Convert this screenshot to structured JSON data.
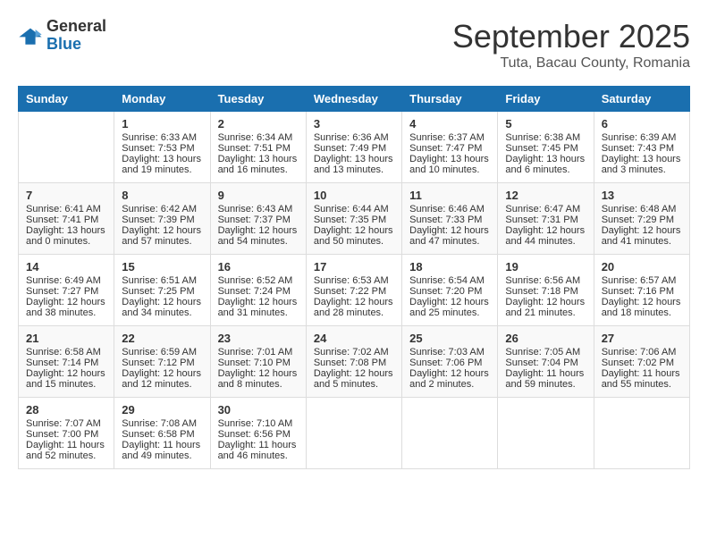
{
  "header": {
    "logo_general": "General",
    "logo_blue": "Blue",
    "month_title": "September 2025",
    "location": "Tuta, Bacau County, Romania"
  },
  "days_of_week": [
    "Sunday",
    "Monday",
    "Tuesday",
    "Wednesday",
    "Thursday",
    "Friday",
    "Saturday"
  ],
  "weeks": [
    [
      {
        "num": "",
        "sunrise": "",
        "sunset": "",
        "daylight": ""
      },
      {
        "num": "1",
        "sunrise": "Sunrise: 6:33 AM",
        "sunset": "Sunset: 7:53 PM",
        "daylight": "Daylight: 13 hours and 19 minutes."
      },
      {
        "num": "2",
        "sunrise": "Sunrise: 6:34 AM",
        "sunset": "Sunset: 7:51 PM",
        "daylight": "Daylight: 13 hours and 16 minutes."
      },
      {
        "num": "3",
        "sunrise": "Sunrise: 6:36 AM",
        "sunset": "Sunset: 7:49 PM",
        "daylight": "Daylight: 13 hours and 13 minutes."
      },
      {
        "num": "4",
        "sunrise": "Sunrise: 6:37 AM",
        "sunset": "Sunset: 7:47 PM",
        "daylight": "Daylight: 13 hours and 10 minutes."
      },
      {
        "num": "5",
        "sunrise": "Sunrise: 6:38 AM",
        "sunset": "Sunset: 7:45 PM",
        "daylight": "Daylight: 13 hours and 6 minutes."
      },
      {
        "num": "6",
        "sunrise": "Sunrise: 6:39 AM",
        "sunset": "Sunset: 7:43 PM",
        "daylight": "Daylight: 13 hours and 3 minutes."
      }
    ],
    [
      {
        "num": "7",
        "sunrise": "Sunrise: 6:41 AM",
        "sunset": "Sunset: 7:41 PM",
        "daylight": "Daylight: 13 hours and 0 minutes."
      },
      {
        "num": "8",
        "sunrise": "Sunrise: 6:42 AM",
        "sunset": "Sunset: 7:39 PM",
        "daylight": "Daylight: 12 hours and 57 minutes."
      },
      {
        "num": "9",
        "sunrise": "Sunrise: 6:43 AM",
        "sunset": "Sunset: 7:37 PM",
        "daylight": "Daylight: 12 hours and 54 minutes."
      },
      {
        "num": "10",
        "sunrise": "Sunrise: 6:44 AM",
        "sunset": "Sunset: 7:35 PM",
        "daylight": "Daylight: 12 hours and 50 minutes."
      },
      {
        "num": "11",
        "sunrise": "Sunrise: 6:46 AM",
        "sunset": "Sunset: 7:33 PM",
        "daylight": "Daylight: 12 hours and 47 minutes."
      },
      {
        "num": "12",
        "sunrise": "Sunrise: 6:47 AM",
        "sunset": "Sunset: 7:31 PM",
        "daylight": "Daylight: 12 hours and 44 minutes."
      },
      {
        "num": "13",
        "sunrise": "Sunrise: 6:48 AM",
        "sunset": "Sunset: 7:29 PM",
        "daylight": "Daylight: 12 hours and 41 minutes."
      }
    ],
    [
      {
        "num": "14",
        "sunrise": "Sunrise: 6:49 AM",
        "sunset": "Sunset: 7:27 PM",
        "daylight": "Daylight: 12 hours and 38 minutes."
      },
      {
        "num": "15",
        "sunrise": "Sunrise: 6:51 AM",
        "sunset": "Sunset: 7:25 PM",
        "daylight": "Daylight: 12 hours and 34 minutes."
      },
      {
        "num": "16",
        "sunrise": "Sunrise: 6:52 AM",
        "sunset": "Sunset: 7:24 PM",
        "daylight": "Daylight: 12 hours and 31 minutes."
      },
      {
        "num": "17",
        "sunrise": "Sunrise: 6:53 AM",
        "sunset": "Sunset: 7:22 PM",
        "daylight": "Daylight: 12 hours and 28 minutes."
      },
      {
        "num": "18",
        "sunrise": "Sunrise: 6:54 AM",
        "sunset": "Sunset: 7:20 PM",
        "daylight": "Daylight: 12 hours and 25 minutes."
      },
      {
        "num": "19",
        "sunrise": "Sunrise: 6:56 AM",
        "sunset": "Sunset: 7:18 PM",
        "daylight": "Daylight: 12 hours and 21 minutes."
      },
      {
        "num": "20",
        "sunrise": "Sunrise: 6:57 AM",
        "sunset": "Sunset: 7:16 PM",
        "daylight": "Daylight: 12 hours and 18 minutes."
      }
    ],
    [
      {
        "num": "21",
        "sunrise": "Sunrise: 6:58 AM",
        "sunset": "Sunset: 7:14 PM",
        "daylight": "Daylight: 12 hours and 15 minutes."
      },
      {
        "num": "22",
        "sunrise": "Sunrise: 6:59 AM",
        "sunset": "Sunset: 7:12 PM",
        "daylight": "Daylight: 12 hours and 12 minutes."
      },
      {
        "num": "23",
        "sunrise": "Sunrise: 7:01 AM",
        "sunset": "Sunset: 7:10 PM",
        "daylight": "Daylight: 12 hours and 8 minutes."
      },
      {
        "num": "24",
        "sunrise": "Sunrise: 7:02 AM",
        "sunset": "Sunset: 7:08 PM",
        "daylight": "Daylight: 12 hours and 5 minutes."
      },
      {
        "num": "25",
        "sunrise": "Sunrise: 7:03 AM",
        "sunset": "Sunset: 7:06 PM",
        "daylight": "Daylight: 12 hours and 2 minutes."
      },
      {
        "num": "26",
        "sunrise": "Sunrise: 7:05 AM",
        "sunset": "Sunset: 7:04 PM",
        "daylight": "Daylight: 11 hours and 59 minutes."
      },
      {
        "num": "27",
        "sunrise": "Sunrise: 7:06 AM",
        "sunset": "Sunset: 7:02 PM",
        "daylight": "Daylight: 11 hours and 55 minutes."
      }
    ],
    [
      {
        "num": "28",
        "sunrise": "Sunrise: 7:07 AM",
        "sunset": "Sunset: 7:00 PM",
        "daylight": "Daylight: 11 hours and 52 minutes."
      },
      {
        "num": "29",
        "sunrise": "Sunrise: 7:08 AM",
        "sunset": "Sunset: 6:58 PM",
        "daylight": "Daylight: 11 hours and 49 minutes."
      },
      {
        "num": "30",
        "sunrise": "Sunrise: 7:10 AM",
        "sunset": "Sunset: 6:56 PM",
        "daylight": "Daylight: 11 hours and 46 minutes."
      },
      {
        "num": "",
        "sunrise": "",
        "sunset": "",
        "daylight": ""
      },
      {
        "num": "",
        "sunrise": "",
        "sunset": "",
        "daylight": ""
      },
      {
        "num": "",
        "sunrise": "",
        "sunset": "",
        "daylight": ""
      },
      {
        "num": "",
        "sunrise": "",
        "sunset": "",
        "daylight": ""
      }
    ]
  ]
}
